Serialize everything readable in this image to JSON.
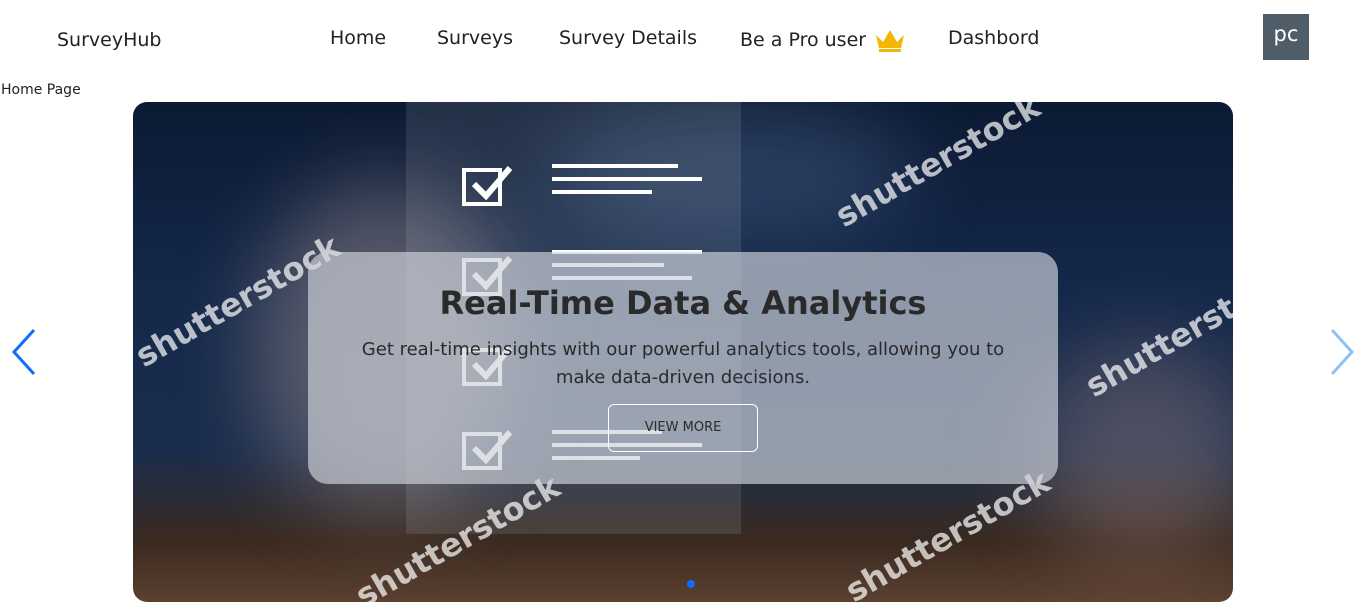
{
  "navbar": {
    "brand": "SurveyHub",
    "links": [
      "Home",
      "Surveys",
      "Survey Details",
      "Be a Pro user",
      "Dashbord"
    ],
    "avatar_initials": "pc"
  },
  "breadcrumb": "Home Page",
  "carousel": {
    "title": "Real-Time Data & Analytics",
    "text": "Get real-time insights with our powerful analytics tools, allowing you to make data-driven decisions.",
    "button": "VIEW MORE",
    "watermark": "shutterstock",
    "active_slide": 1,
    "slide_count": 1
  },
  "colors": {
    "accent": "#0d6efd",
    "crown": "#f2b705",
    "avatar_bg": "#4e5d68"
  }
}
